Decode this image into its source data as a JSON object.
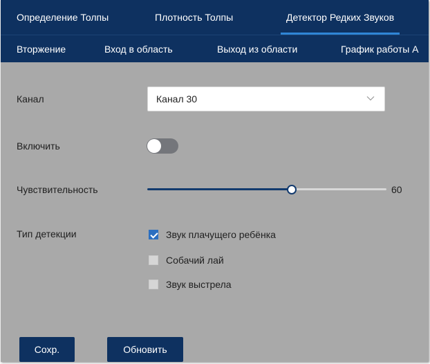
{
  "tabs_row1": [
    {
      "label": "Определение Толпы",
      "active": false
    },
    {
      "label": "Плотность Толпы",
      "active": false
    },
    {
      "label": "Детектор Редких Звуков",
      "active": true
    }
  ],
  "tabs_row2": [
    {
      "label": "Вторжение"
    },
    {
      "label": "Вход в область"
    },
    {
      "label": "Выход из области"
    },
    {
      "label": "График работы А"
    }
  ],
  "form": {
    "channel": {
      "label": "Канал",
      "value": "Канал 30"
    },
    "enable": {
      "label": "Включить",
      "on": false
    },
    "sensitivity": {
      "label": "Чувствительность",
      "value": "60",
      "fraction": 0.6
    },
    "detection_type": {
      "label": "Тип детекции",
      "options": [
        {
          "label": "Звук плачущего ребёнка",
          "checked": true
        },
        {
          "label": "Собачий лай",
          "checked": false
        },
        {
          "label": "Звук выстрела",
          "checked": false
        }
      ]
    }
  },
  "buttons": {
    "save": "Сохр.",
    "refresh": "Обновить"
  },
  "colors": {
    "nav_bg": "#0e3160",
    "active_tab_underline": "#2f86d6",
    "content_bg": "#a9a9a9",
    "slider_fill": "#123a6e",
    "checkbox_checked": "#2c6fc0"
  },
  "icons": {
    "select_arrow": "chevron-down-icon",
    "check": "check-icon"
  }
}
